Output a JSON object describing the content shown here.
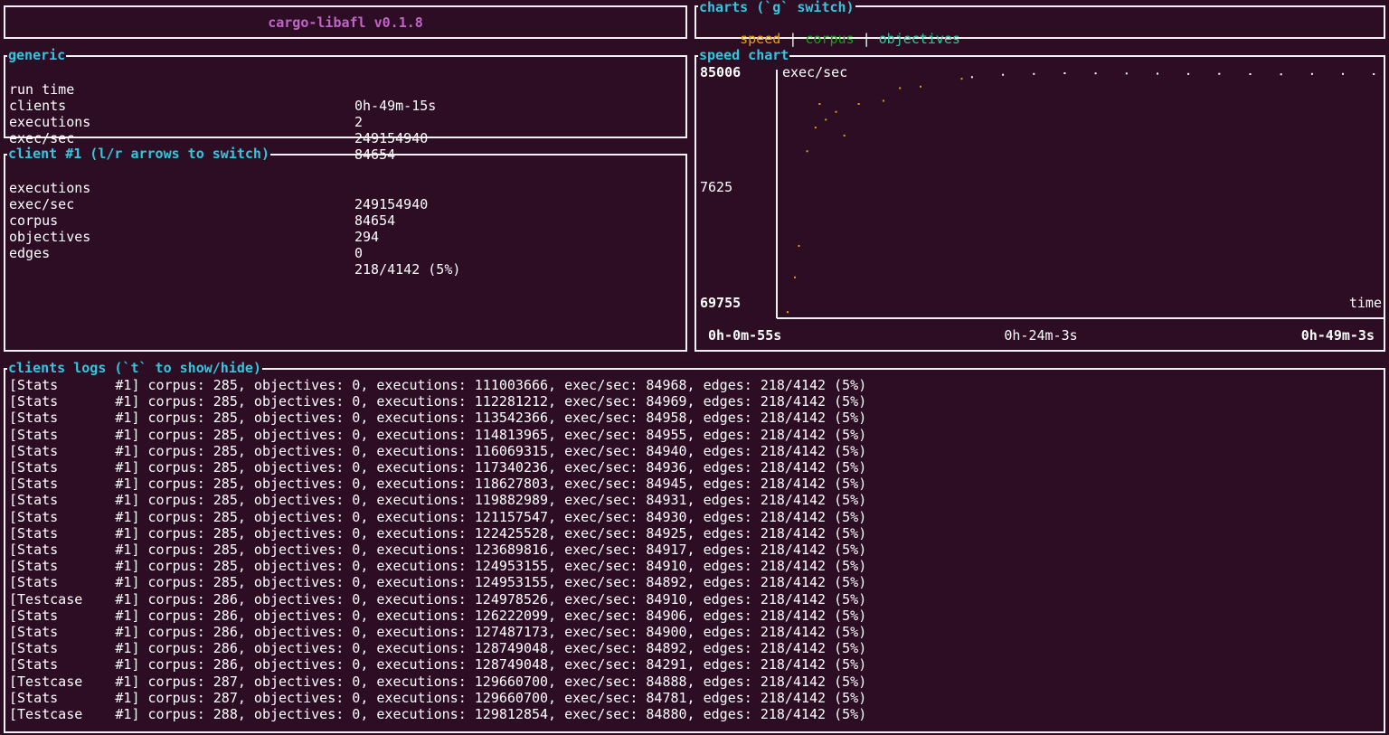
{
  "title": "cargo-libafl v0.1.8",
  "colors": {
    "speed": "#e6a000",
    "corpus": "#13a10e",
    "objectives": "#2fc79a"
  },
  "charts": {
    "title": "charts (`g` switch)",
    "tabs": [
      "speed",
      "corpus",
      "objectives"
    ],
    "separator": "|"
  },
  "generic": {
    "title": "generic",
    "rows": [
      {
        "label": "run time",
        "value": "0h-49m-15s"
      },
      {
        "label": "clients",
        "value": "2"
      },
      {
        "label": "executions",
        "value": "249154940"
      },
      {
        "label": "exec/sec",
        "value": "84654"
      }
    ]
  },
  "client": {
    "title": "client #1 (l/r arrows to switch)",
    "rows": [
      {
        "label": "executions",
        "value": "249154940"
      },
      {
        "label": "exec/sec",
        "value": "84654"
      },
      {
        "label": "corpus",
        "value": "294"
      },
      {
        "label": "objectives",
        "value": "0"
      },
      {
        "label": "edges",
        "value": "218/4142 (5%)"
      }
    ]
  },
  "speed_chart": {
    "title": "speed chart",
    "ylabel": "exec/sec",
    "xlabel": "time",
    "y_ticks": [
      "85006",
      "7625",
      "69755"
    ],
    "x_ticks": [
      "0h-0m-55s",
      "0h-24m-3s",
      "0h-49m-3s"
    ]
  },
  "chart_data": {
    "type": "scatter",
    "xlabel": "time",
    "ylabel": "exec/sec",
    "ylim": [
      69755,
      85006
    ],
    "x_range_seconds": [
      55,
      2943
    ],
    "series": [
      {
        "color": "#e6a000",
        "x": [
          55,
          90,
          110,
          150,
          190,
          210,
          240,
          290,
          330,
          400,
          520,
          600,
          700,
          900
        ],
        "y": [
          69800,
          72000,
          74000,
          80000,
          81500,
          83000,
          82000,
          82500,
          81000,
          83000,
          83200,
          84000,
          84100,
          84600
        ]
      },
      {
        "color": "#ffffff",
        "x": [
          950,
          1100,
          1250,
          1400,
          1550,
          1700,
          1850,
          2000,
          2150,
          2300,
          2450,
          2600,
          2750,
          2900
        ],
        "y": [
          84700,
          84850,
          84900,
          84950,
          84940,
          84930,
          84920,
          84900,
          84910,
          84890,
          84880,
          84905,
          84900,
          84890
        ]
      }
    ]
  },
  "logs": {
    "title": "clients logs (`t` to show/hide)",
    "lines": [
      "[Stats       #1] corpus: 285, objectives: 0, executions: 111003666, exec/sec: 84968, edges: 218/4142 (5%)",
      "[Stats       #1] corpus: 285, objectives: 0, executions: 112281212, exec/sec: 84969, edges: 218/4142 (5%)",
      "[Stats       #1] corpus: 285, objectives: 0, executions: 113542366, exec/sec: 84958, edges: 218/4142 (5%)",
      "[Stats       #1] corpus: 285, objectives: 0, executions: 114813965, exec/sec: 84955, edges: 218/4142 (5%)",
      "[Stats       #1] corpus: 285, objectives: 0, executions: 116069315, exec/sec: 84940, edges: 218/4142 (5%)",
      "[Stats       #1] corpus: 285, objectives: 0, executions: 117340236, exec/sec: 84936, edges: 218/4142 (5%)",
      "[Stats       #1] corpus: 285, objectives: 0, executions: 118627803, exec/sec: 84945, edges: 218/4142 (5%)",
      "[Stats       #1] corpus: 285, objectives: 0, executions: 119882989, exec/sec: 84931, edges: 218/4142 (5%)",
      "[Stats       #1] corpus: 285, objectives: 0, executions: 121157547, exec/sec: 84930, edges: 218/4142 (5%)",
      "[Stats       #1] corpus: 285, objectives: 0, executions: 122425528, exec/sec: 84925, edges: 218/4142 (5%)",
      "[Stats       #1] corpus: 285, objectives: 0, executions: 123689816, exec/sec: 84917, edges: 218/4142 (5%)",
      "[Stats       #1] corpus: 285, objectives: 0, executions: 124953155, exec/sec: 84910, edges: 218/4142 (5%)",
      "[Stats       #1] corpus: 285, objectives: 0, executions: 124953155, exec/sec: 84892, edges: 218/4142 (5%)",
      "[Testcase    #1] corpus: 286, objectives: 0, executions: 124978526, exec/sec: 84910, edges: 218/4142 (5%)",
      "[Stats       #1] corpus: 286, objectives: 0, executions: 126222099, exec/sec: 84906, edges: 218/4142 (5%)",
      "[Stats       #1] corpus: 286, objectives: 0, executions: 127487173, exec/sec: 84900, edges: 218/4142 (5%)",
      "[Stats       #1] corpus: 286, objectives: 0, executions: 128749048, exec/sec: 84892, edges: 218/4142 (5%)",
      "[Stats       #1] corpus: 286, objectives: 0, executions: 128749048, exec/sec: 84291, edges: 218/4142 (5%)",
      "[Testcase    #1] corpus: 287, objectives: 0, executions: 129660700, exec/sec: 84888, edges: 218/4142 (5%)",
      "[Stats       #1] corpus: 287, objectives: 0, executions: 129660700, exec/sec: 84781, edges: 218/4142 (5%)",
      "[Testcase    #1] corpus: 288, objectives: 0, executions: 129812854, exec/sec: 84880, edges: 218/4142 (5%)"
    ]
  }
}
